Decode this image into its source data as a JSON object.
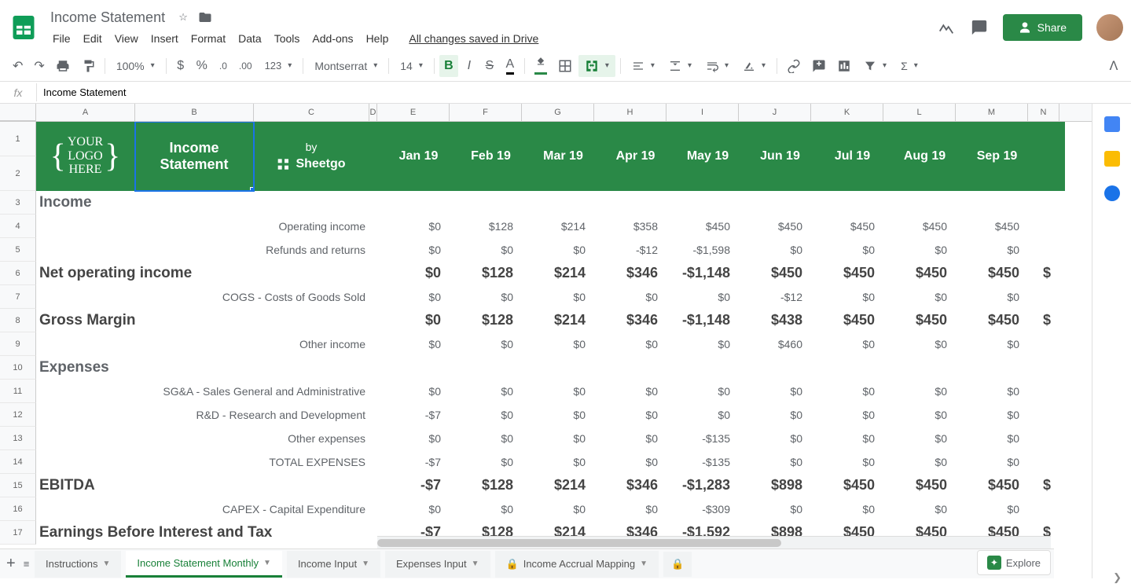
{
  "doc": {
    "title": "Income Statement",
    "save_status": "All changes saved in Drive"
  },
  "menus": [
    "File",
    "Edit",
    "View",
    "Insert",
    "Format",
    "Data",
    "Tools",
    "Add-ons",
    "Help"
  ],
  "share": "Share",
  "toolbar": {
    "zoom": "100%",
    "font": "Montserrat",
    "size": "14"
  },
  "formula": "Income Statement",
  "col_letters": [
    "A",
    "B",
    "C",
    "D",
    "E",
    "F",
    "G",
    "H",
    "I",
    "J",
    "K",
    "L",
    "M",
    "N"
  ],
  "logo_here": [
    "YOUR",
    "LOGO",
    "HERE"
  ],
  "inc_stmt": "Income\nStatement",
  "by": "by",
  "sheetgo": "Sheetgo",
  "months": [
    "Jan 19",
    "Feb 19",
    "Mar 19",
    "Apr 19",
    "May 19",
    "Jun 19",
    "Jul 19",
    "Aug 19",
    "Sep 19"
  ],
  "rows": [
    {
      "n": 3,
      "type": "section",
      "label": "Income"
    },
    {
      "n": 4,
      "type": "data",
      "label": "Operating income",
      "vals": [
        "$0",
        "$128",
        "$214",
        "$358",
        "$450",
        "$450",
        "$450",
        "$450",
        "$450"
      ]
    },
    {
      "n": 5,
      "type": "data",
      "label": "Refunds and returns",
      "vals": [
        "$0",
        "$0",
        "$0",
        "-$12",
        "-$1,598",
        "$0",
        "$0",
        "$0",
        "$0"
      ]
    },
    {
      "n": 6,
      "type": "bold",
      "label": "Net operating income",
      "vals": [
        "$0",
        "$128",
        "$214",
        "$346",
        "-$1,148",
        "$450",
        "$450",
        "$450",
        "$450"
      ],
      "peek": "$"
    },
    {
      "n": 7,
      "type": "data",
      "label": "COGS - Costs of Goods Sold",
      "vals": [
        "$0",
        "$0",
        "$0",
        "$0",
        "$0",
        "-$12",
        "$0",
        "$0",
        "$0"
      ]
    },
    {
      "n": 8,
      "type": "bold",
      "label": "Gross Margin",
      "vals": [
        "$0",
        "$128",
        "$214",
        "$346",
        "-$1,148",
        "$438",
        "$450",
        "$450",
        "$450"
      ],
      "peek": "$"
    },
    {
      "n": 9,
      "type": "data",
      "label": "Other income",
      "vals": [
        "$0",
        "$0",
        "$0",
        "$0",
        "$0",
        "$460",
        "$0",
        "$0",
        "$0"
      ]
    },
    {
      "n": 10,
      "type": "section",
      "label": "Expenses"
    },
    {
      "n": 11,
      "type": "data",
      "label": "SG&A - Sales General and Administrative",
      "vals": [
        "$0",
        "$0",
        "$0",
        "$0",
        "$0",
        "$0",
        "$0",
        "$0",
        "$0"
      ]
    },
    {
      "n": 12,
      "type": "data",
      "label": "R&D - Research and Development",
      "vals": [
        "-$7",
        "$0",
        "$0",
        "$0",
        "$0",
        "$0",
        "$0",
        "$0",
        "$0"
      ]
    },
    {
      "n": 13,
      "type": "data",
      "label": "Other expenses",
      "vals": [
        "$0",
        "$0",
        "$0",
        "$0",
        "-$135",
        "$0",
        "$0",
        "$0",
        "$0"
      ]
    },
    {
      "n": 14,
      "type": "data",
      "label": "TOTAL EXPENSES",
      "vals": [
        "-$7",
        "$0",
        "$0",
        "$0",
        "-$135",
        "$0",
        "$0",
        "$0",
        "$0"
      ]
    },
    {
      "n": 15,
      "type": "bold",
      "label": "EBITDA",
      "vals": [
        "-$7",
        "$128",
        "$214",
        "$346",
        "-$1,283",
        "$898",
        "$450",
        "$450",
        "$450"
      ],
      "peek": "$"
    },
    {
      "n": 16,
      "type": "data",
      "label": "CAPEX - Capital Expenditure",
      "vals": [
        "$0",
        "$0",
        "$0",
        "$0",
        "-$309",
        "$0",
        "$0",
        "$0",
        "$0"
      ]
    },
    {
      "n": 17,
      "type": "bold",
      "label": "Earnings Before Interest and Tax",
      "vals": [
        "-$7",
        "$128",
        "$214",
        "$346",
        "-$1,592",
        "$898",
        "$450",
        "$450",
        "$450"
      ],
      "peek": "$"
    }
  ],
  "tabs": [
    {
      "label": "Instructions",
      "active": false,
      "lock": false
    },
    {
      "label": "Income Statement Monthly",
      "active": true,
      "lock": false
    },
    {
      "label": "Income Input",
      "active": false,
      "lock": false
    },
    {
      "label": "Expenses Input",
      "active": false,
      "lock": false
    },
    {
      "label": "Income Accrual Mapping",
      "active": false,
      "lock": true
    }
  ],
  "explore": "Explore"
}
